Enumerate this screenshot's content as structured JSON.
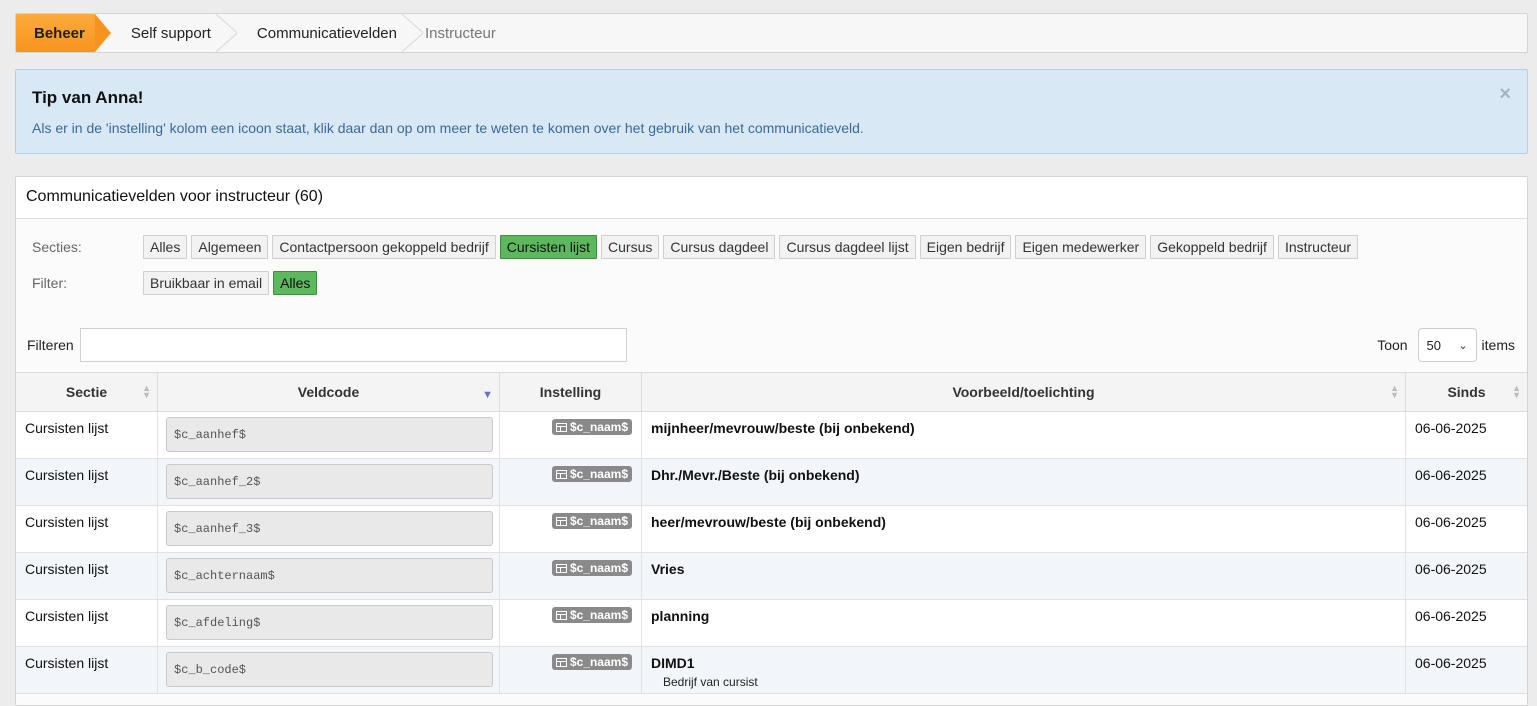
{
  "breadcrumb": [
    "Beheer",
    "Self support",
    "Communicatievelden",
    "Instructeur"
  ],
  "alert": {
    "title": "Tip van Anna!",
    "text": "Als er in de 'instelling' kolom een icoon staat, klik daar dan op om meer te weten te komen over het gebruik van het communicatieveld.",
    "close": "×"
  },
  "panel": {
    "title": "Communicatievelden voor instructeur (60)",
    "sections_label": "Secties:",
    "sections": [
      "Alles",
      "Algemeen",
      "Contactpersoon gekoppeld bedrijf",
      "Cursisten lijst",
      "Cursus",
      "Cursus dagdeel",
      "Cursus dagdeel lijst",
      "Eigen bedrijf",
      "Eigen medewerker",
      "Gekoppeld bedrijf",
      "Instructeur"
    ],
    "active_section": "Cursisten lijst",
    "filter_label": "Filter:",
    "filters": [
      "Bruikbaar in email",
      "Alles"
    ],
    "active_filter": "Alles",
    "search_label": "Filteren",
    "search_value": "",
    "toon_label": "Toon",
    "page_size": "50",
    "items_label": "items"
  },
  "table": {
    "headers": [
      "Sectie",
      "Veldcode",
      "Instelling",
      "Voorbeeld/toelichting",
      "Sinds"
    ],
    "rows": [
      {
        "sectie": "Cursisten lijst",
        "code": "$c_aanhef$",
        "badge": "$c_naam$",
        "example": "mijnheer/mevrouw/beste (bij onbekend)",
        "sub": "",
        "since": "06-06-2025"
      },
      {
        "sectie": "Cursisten lijst",
        "code": "$c_aanhef_2$",
        "badge": "$c_naam$",
        "example": "Dhr./Mevr./Beste (bij onbekend)",
        "sub": "",
        "since": "06-06-2025"
      },
      {
        "sectie": "Cursisten lijst",
        "code": "$c_aanhef_3$",
        "badge": "$c_naam$",
        "example": "heer/mevrouw/beste (bij onbekend)",
        "sub": "",
        "since": "06-06-2025"
      },
      {
        "sectie": "Cursisten lijst",
        "code": "$c_achternaam$",
        "badge": "$c_naam$",
        "example": "Vries",
        "sub": "",
        "since": "06-06-2025"
      },
      {
        "sectie": "Cursisten lijst",
        "code": "$c_afdeling$",
        "badge": "$c_naam$",
        "example": "planning",
        "sub": "",
        "since": "06-06-2025"
      },
      {
        "sectie": "Cursisten lijst",
        "code": "$c_b_code$",
        "badge": "$c_naam$",
        "example": "DIMD1",
        "sub": "Bedrijf van cursist",
        "since": "06-06-2025"
      }
    ]
  }
}
